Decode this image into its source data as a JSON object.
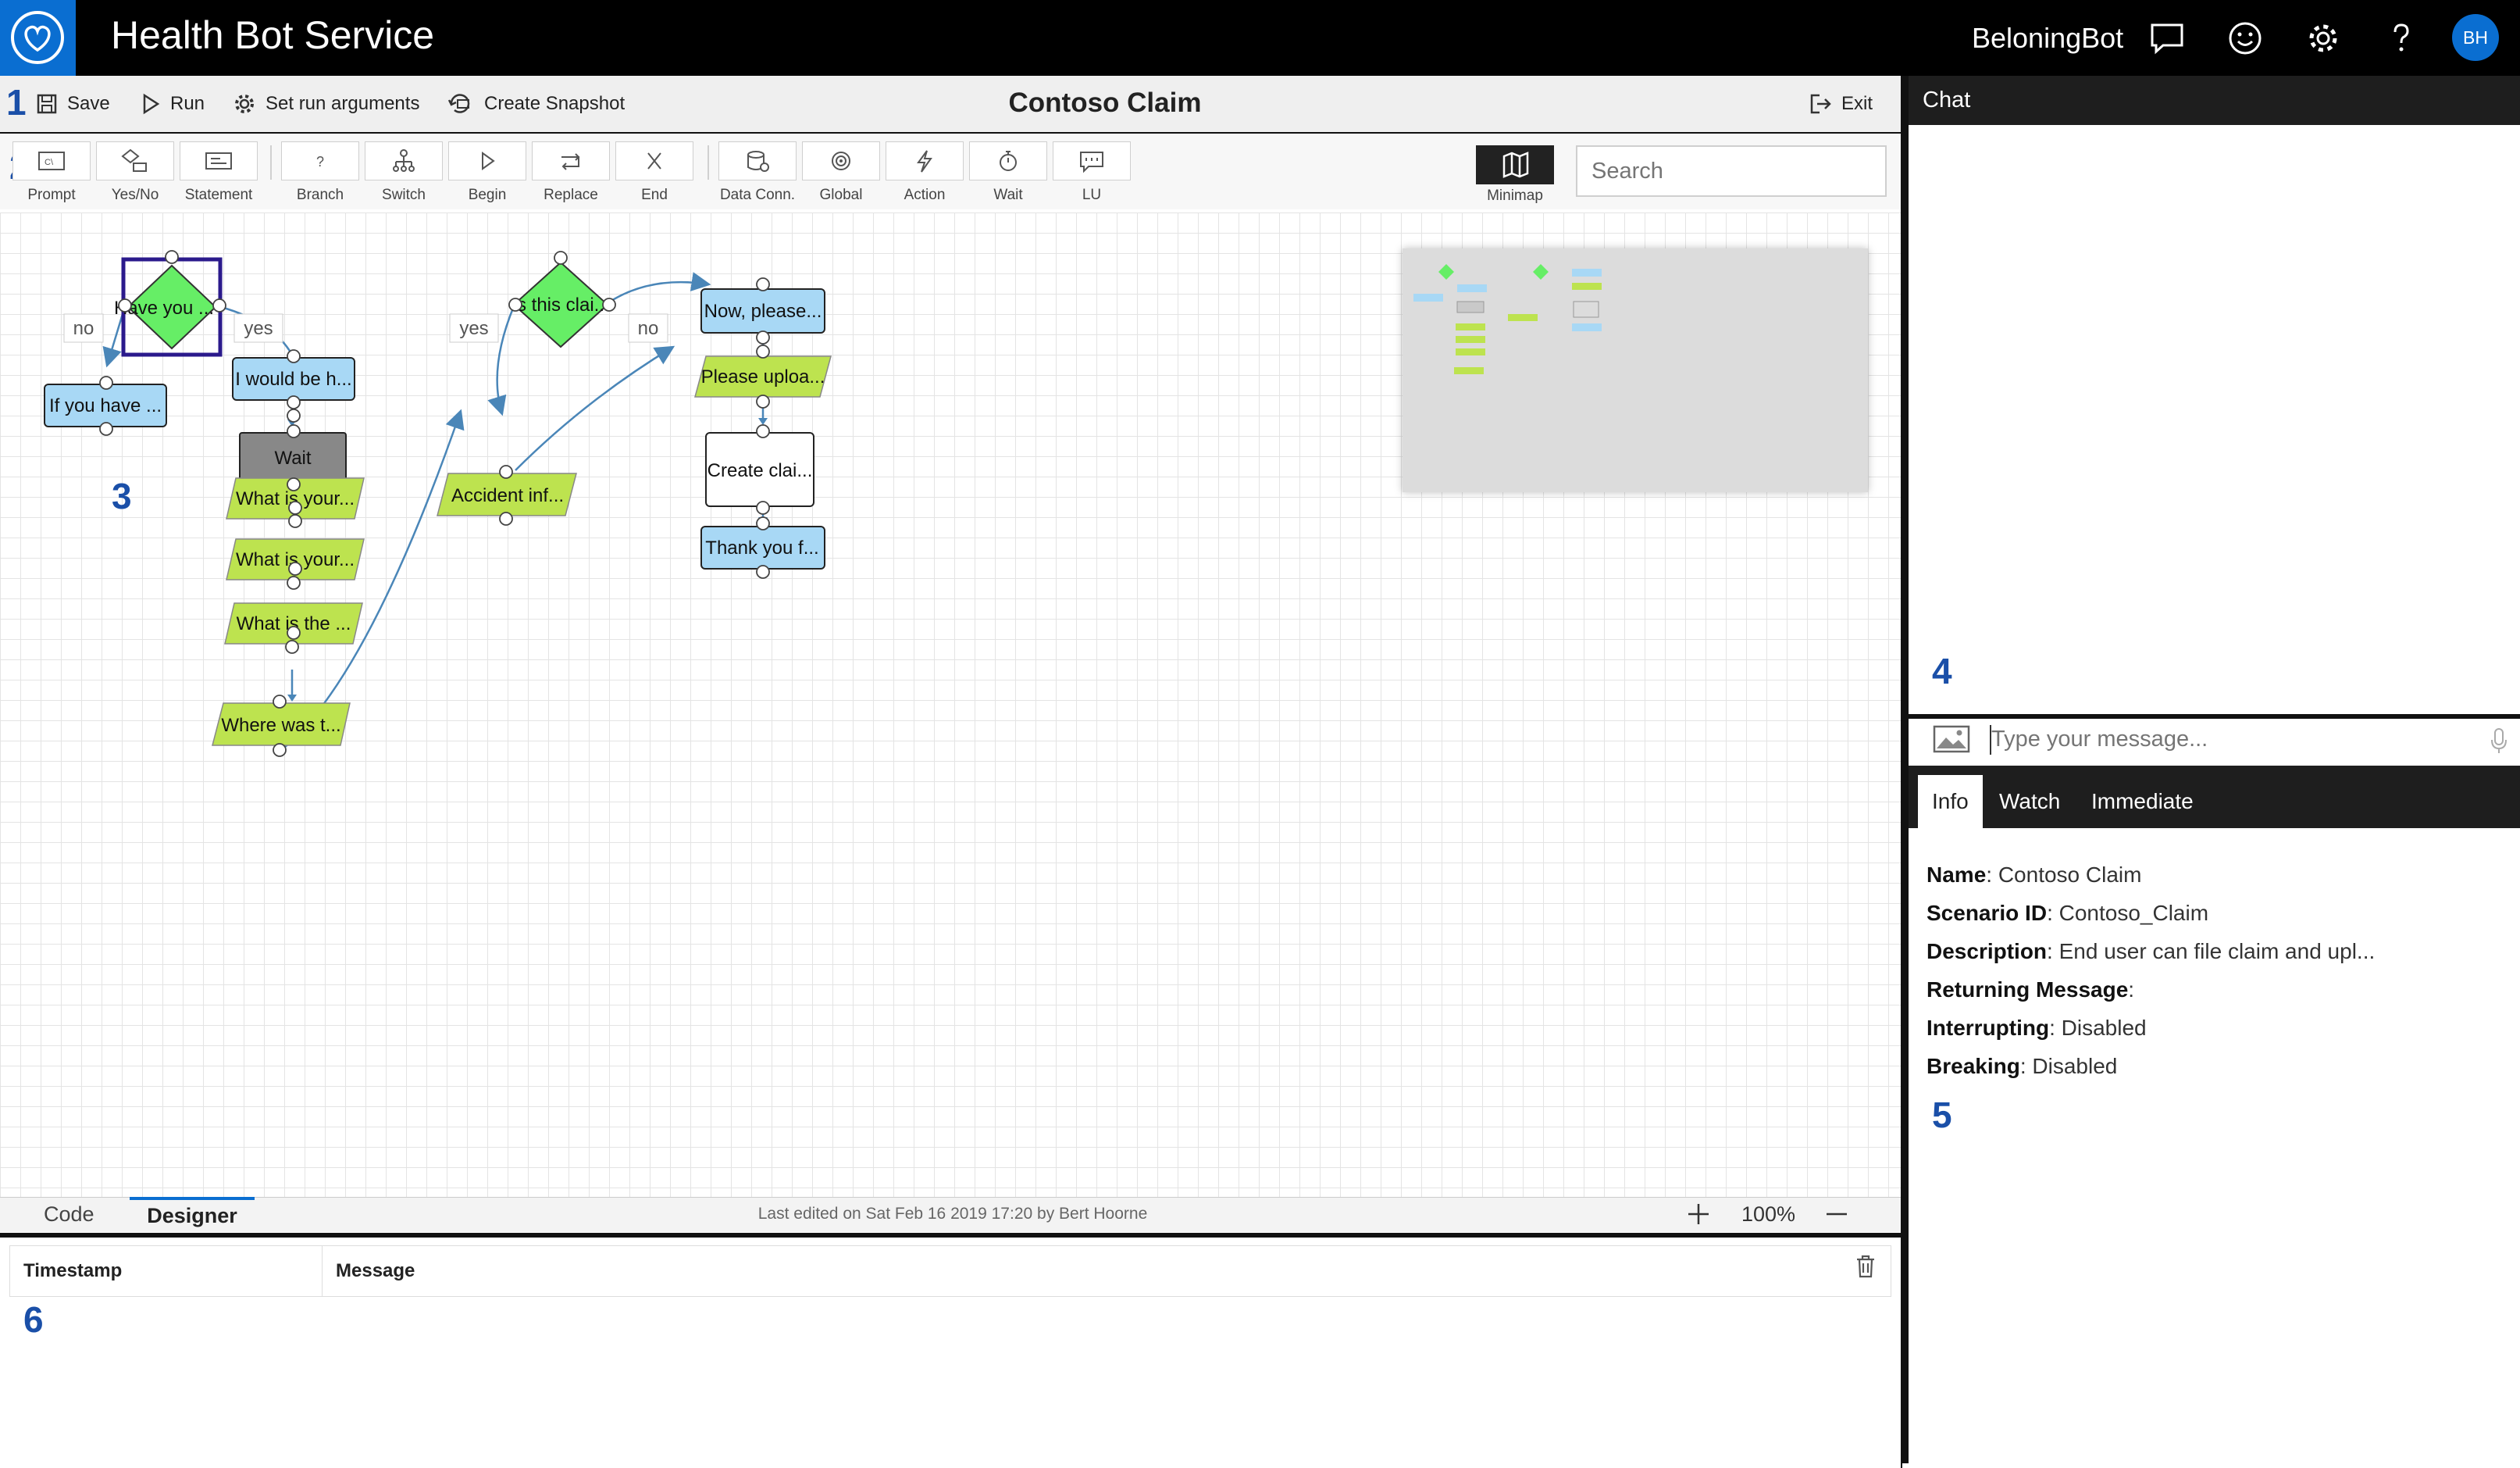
{
  "app": {
    "title": "Health Bot Service",
    "bot_name": "BeloningBot",
    "avatar_initials": "BH"
  },
  "toolbar1": {
    "save": "Save",
    "run": "Run",
    "set_args": "Set run arguments",
    "snapshot": "Create Snapshot",
    "exit": "Exit"
  },
  "scenario": {
    "title": "Contoso Claim"
  },
  "toolbar2": {
    "tools": [
      "Prompt",
      "Yes/No",
      "Statement",
      "Branch",
      "Switch",
      "Begin",
      "Replace",
      "End",
      "Data Conn.",
      "Global",
      "Action",
      "Wait",
      "LU"
    ],
    "minimap": "Minimap",
    "search_placeholder": "Search"
  },
  "flow": {
    "nodes": {
      "have_you": "Have you ...",
      "if_you_have": "If you have ...",
      "i_would_be": "I would be h...",
      "wait": "Wait",
      "what_is_your_1": "What is your...",
      "what_is_your_2": "What is your...",
      "what_is_the": "What is the ...",
      "where_was": "Where was t...",
      "is_this_claim": "Is this clai...",
      "accident": "Accident inf...",
      "now_please": "Now, please...",
      "please_upload": "Please uploa...",
      "create_claim": "Create clai...",
      "thank_you": "Thank you f..."
    },
    "edge_labels": {
      "no1": "no",
      "yes1": "yes",
      "yes2": "yes",
      "no2": "no"
    }
  },
  "annotations": [
    "1",
    "2",
    "3",
    "4",
    "5",
    "6"
  ],
  "bottom": {
    "tab_code": "Code",
    "tab_designer": "Designer",
    "last_edited": "Last edited on Sat Feb 16 2019 17:20 by Bert Hoorne",
    "zoom": "100%"
  },
  "log": {
    "col_timestamp": "Timestamp",
    "col_message": "Message"
  },
  "chat": {
    "title": "Chat",
    "input_placeholder": "Type your message..."
  },
  "info_tabs": [
    "Info",
    "Watch",
    "Immediate"
  ],
  "info": {
    "name_label": "Name",
    "name": "Contoso Claim",
    "scenario_id_label": "Scenario ID",
    "scenario_id": "Contoso_Claim",
    "description_label": "Description",
    "description": "End user can file claim and upl...",
    "returning_label": "Returning Message",
    "returning": "",
    "interrupting_label": "Interrupting",
    "interrupting": "Disabled",
    "breaking_label": "Breaking",
    "breaking": "Disabled"
  },
  "colors": {
    "accent": "#0a6ed1",
    "yesno_node": "#66ee66",
    "prompt_node": "#bde34f",
    "statement_node": "#a8d8f5",
    "wait_node": "#888888",
    "selection": "#2b1a8c",
    "edge": "#4a86b8"
  }
}
